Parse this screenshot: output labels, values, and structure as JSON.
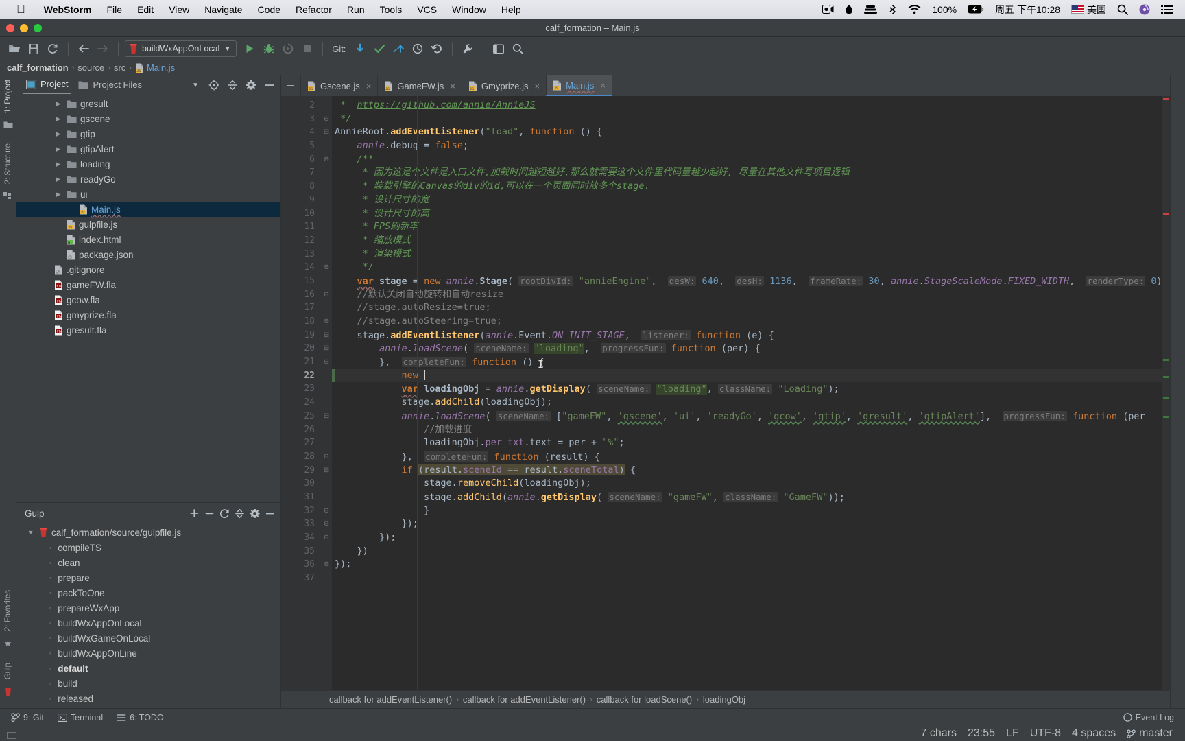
{
  "macmenu": {
    "apple_icon": "apple-icon",
    "app_name": "WebStorm",
    "items": [
      "File",
      "Edit",
      "View",
      "Navigate",
      "Code",
      "Refactor",
      "Run",
      "Tools",
      "VCS",
      "Window",
      "Help"
    ],
    "status": {
      "screen_record_icon": "screen-record-icon",
      "shield_icon": "shield-icon",
      "stack_icon": "stack-icon",
      "bluetooth_icon": "bluetooth-icon",
      "wifi_icon": "wifi-icon",
      "battery_percent": "100%",
      "battery_icon": "battery-charging-icon",
      "datetime": "周五 下午10:28",
      "input_source": "美国",
      "search_icon": "search-icon",
      "siri_icon": "siri-icon",
      "control_center_icon": "control-center-icon"
    }
  },
  "window": {
    "title": "calf_formation – Main.js"
  },
  "toolbar": {
    "open_icon": "open-folder-icon",
    "save_icon": "save-icon",
    "sync_icon": "sync-icon",
    "back_icon": "back-arrow-icon",
    "forward_icon": "forward-arrow-icon",
    "run_config": "buildWxAppOnLocal",
    "run_config_icon": "gulp-task-icon",
    "dropdown_icon": "chevron-down-icon",
    "run_icon": "run-icon",
    "debug_icon": "debug-icon",
    "coverage_icon": "run-coverage-icon",
    "stop_icon": "stop-icon",
    "git_label": "Git:",
    "git_update_icon": "update-project-icon",
    "git_commit_icon": "commit-checkmark-icon",
    "git_push_icon": "push-icon",
    "git_history_icon": "history-clock-icon",
    "git_revert_icon": "revert-icon",
    "settings_icon": "wrench-icon",
    "layout_icon": "layout-icon",
    "search_icon": "search-icon"
  },
  "breadcrumb": {
    "items": [
      {
        "label": "calf_formation",
        "icon": ""
      },
      {
        "label": "source",
        "icon": ""
      },
      {
        "label": "src",
        "icon": ""
      },
      {
        "label": "Main.js",
        "icon": "js-file-icon"
      }
    ],
    "separator": "›"
  },
  "left_rail": {
    "tabs": [
      {
        "label": "1: Project",
        "icon": "project-icon"
      },
      {
        "label": "2: Structure",
        "icon": "structure-icon"
      }
    ],
    "bottom_tabs": [
      {
        "label": "2: Favorites",
        "icon": "star-icon"
      },
      {
        "label": "Gulp",
        "icon": "gulp-icon"
      }
    ]
  },
  "project_panel": {
    "tabs": [
      {
        "label": "Project",
        "icon": "project-view-icon",
        "active": true
      },
      {
        "label": "Project Files",
        "icon": "folder-icon",
        "active": false
      }
    ],
    "header_icons": [
      "chevron-down-icon",
      "target-locate-icon",
      "collapse-all-icon",
      "gear-icon",
      "hide-icon"
    ],
    "tree": [
      {
        "label": "gresult",
        "icon": "folder-icon",
        "arrow": "▶",
        "indent": 3,
        "selected": false
      },
      {
        "label": "gscene",
        "icon": "folder-icon",
        "arrow": "▶",
        "indent": 3,
        "selected": false
      },
      {
        "label": "gtip",
        "icon": "folder-icon",
        "arrow": "▶",
        "indent": 3,
        "selected": false
      },
      {
        "label": "gtipAlert",
        "icon": "folder-icon",
        "arrow": "▶",
        "indent": 3,
        "selected": false
      },
      {
        "label": "loading",
        "icon": "folder-icon",
        "arrow": "▶",
        "indent": 3,
        "selected": false
      },
      {
        "label": "readyGo",
        "icon": "folder-icon",
        "arrow": "▶",
        "indent": 3,
        "selected": false
      },
      {
        "label": "ui",
        "icon": "folder-icon",
        "arrow": "▶",
        "indent": 3,
        "selected": false
      },
      {
        "label": "Main.js",
        "icon": "js-file-icon",
        "arrow": "",
        "indent": 4,
        "selected": true
      },
      {
        "label": "gulpfile.js",
        "icon": "js-file-icon",
        "arrow": "",
        "indent": 3,
        "selected": false
      },
      {
        "label": "index.html",
        "icon": "html-file-icon",
        "arrow": "",
        "indent": 3,
        "selected": false
      },
      {
        "label": "package.json",
        "icon": "json-file-icon",
        "arrow": "",
        "indent": 3,
        "selected": false
      },
      {
        "label": ".gitignore",
        "icon": "gitignore-file-icon",
        "arrow": "",
        "indent": 2,
        "selected": false
      },
      {
        "label": "gameFW.fla",
        "icon": "fla-file-icon",
        "arrow": "",
        "indent": 2,
        "selected": false
      },
      {
        "label": "gcow.fla",
        "icon": "fla-file-icon",
        "arrow": "",
        "indent": 2,
        "selected": false
      },
      {
        "label": "gmyprize.fla",
        "icon": "fla-file-icon",
        "arrow": "",
        "indent": 2,
        "selected": false
      },
      {
        "label": "gresult.fla",
        "icon": "fla-file-icon",
        "arrow": "",
        "indent": 2,
        "selected": false
      }
    ]
  },
  "gulp_panel": {
    "title": "Gulp",
    "header_icons": [
      "add-icon",
      "remove-icon",
      "refresh-icon",
      "collapse-all-icon",
      "gear-icon",
      "hide-icon"
    ],
    "root": {
      "label": "calf_formation/source/gulpfile.js",
      "arrow": "▼",
      "icon": "gulp-icon"
    },
    "tasks": [
      {
        "label": "compileTS",
        "bold": false
      },
      {
        "label": "clean",
        "bold": false
      },
      {
        "label": "prepare",
        "bold": false
      },
      {
        "label": "packToOne",
        "bold": false
      },
      {
        "label": "prepareWxApp",
        "bold": false
      },
      {
        "label": "buildWxAppOnLocal",
        "bold": false
      },
      {
        "label": "buildWxGameOnLocal",
        "bold": false
      },
      {
        "label": "buildWxAppOnLine",
        "bold": false
      },
      {
        "label": "default",
        "bold": true
      },
      {
        "label": "build",
        "bold": false
      },
      {
        "label": "released",
        "bold": false
      }
    ]
  },
  "editor": {
    "tabs": [
      {
        "label": "Gscene.js",
        "icon": "js-file-icon",
        "active": false,
        "close": "×"
      },
      {
        "label": "GameFW.js",
        "icon": "js-file-icon",
        "active": false,
        "close": "×"
      },
      {
        "label": "Gmyprize.js",
        "icon": "js-file-icon",
        "active": false,
        "close": "×"
      },
      {
        "label": "Main.js",
        "icon": "js-file-icon",
        "active": true,
        "close": "×"
      }
    ],
    "hide_icon": "hide-tabs-icon",
    "first_line_number": 2,
    "current_line": 22,
    "line_numbers": [
      2,
      3,
      4,
      5,
      6,
      7,
      8,
      9,
      10,
      11,
      12,
      13,
      14,
      15,
      16,
      17,
      18,
      19,
      20,
      21,
      22,
      23,
      24,
      25,
      26,
      27,
      28,
      29,
      30,
      31,
      32,
      33,
      34,
      35,
      36,
      37
    ],
    "folds": {
      "3": "⊖",
      "4": "⊟",
      "6": "⊖",
      "14": "⊖",
      "16": "⊖",
      "18": "⊖",
      "19": "⊟",
      "20": "⊟",
      "21": "⊖",
      "25": "⊟",
      "28": "⊖",
      "29": "⊟",
      "32": "⊖",
      "33": "⊖",
      "34": "⊖",
      "36": "⊖"
    },
    "breadcrumb": [
      "callback for addEventListener()",
      "callback for addEventListener()",
      "callback for loadScene()",
      "loadingObj"
    ],
    "breadcrumb_separator": "›",
    "code": [
      " *  https://github.com/annie/AnnieJS",
      " */",
      "AnnieRoot.addEventListener(\"load\", function () {",
      "    annie.debug = false;",
      "    /**",
      "     * 因为这是个文件是入口文件,加载时间越短越好,那么就需要这个文件里代码量越少越好, 尽量在其他文件写项目逻辑",
      "     * 装载引擎的Canvas的div的id,可以在一个页面同时放多个stage.",
      "     * 设计尺寸的宽",
      "     * 设计尺寸的高",
      "     * FPS刷新率",
      "     * 缩放模式",
      "     * 渲染模式",
      "     */",
      "    var stage = new annie.Stage( rootDivId: \"annieEngine\",  desW: 640,  desH: 1136,  frameRate: 30, annie.StageScaleMode.FIXED_WIDTH,  renderType: 0);",
      "    //默认关闭自动旋转和自动resize",
      "    //stage.autoResize=true;",
      "    //stage.autoSteering=true;",
      "    stage.addEventListener(annie.Event.ON_INIT_STAGE,  listener: function (e) {",
      "        annie.loadScene( sceneName: \"loading\",  progressFun: function (per) {",
      "        },  completeFun: function () {",
      "            new ",
      "            var loadingObj = annie.getDisplay( sceneName: \"loading\", className: \"Loading\");",
      "            stage.addChild(loadingObj);",
      "            annie.loadScene( sceneName: [\"gameFW\", 'gscene', 'ui', 'readyGo', 'gcow', 'gtip', 'gresult', 'gtipAlert'],  progressFun: function (per",
      "                //加载进度",
      "                loadingObj.per_txt.text = per + \"%\";",
      "            },  completeFun: function (result) {",
      "                if (result.sceneId == result.sceneTotal) {",
      "                    stage.removeChild(loadingObj);",
      "                    stage.addChild(annie.getDisplay( sceneName: \"gameFW\", className: \"GameFW\"));",
      "                }",
      "            });",
      "        });",
      "    })",
      "});",
      ""
    ]
  },
  "status_bar": {
    "left": [
      {
        "label": "9: Git",
        "icon": "git-branch-icon"
      },
      {
        "label": "Terminal",
        "icon": "terminal-icon"
      },
      {
        "label": "6: TODO",
        "icon": "todo-icon"
      }
    ],
    "event_log": {
      "label": "Event Log",
      "icon": "event-log-icon"
    },
    "right": [
      {
        "label": "7 chars",
        "name": "char-count"
      },
      {
        "label": "23:55",
        "name": "caret-position"
      },
      {
        "label": "LF",
        "name": "line-separator"
      },
      {
        "label": "UTF-8",
        "name": "file-encoding"
      },
      {
        "label": "4 spaces",
        "name": "indent-setting"
      },
      {
        "label": "master",
        "name": "git-branch",
        "icon": "git-branch-icon"
      }
    ]
  },
  "colors": {
    "accent_blue": "#4a88c7",
    "panel_bg": "#3c3f41",
    "editor_bg": "#2b2b2b",
    "selection_blue": "#0d293e",
    "string_green": "#6a8759",
    "keyword_orange": "#cc7832",
    "function_yellow": "#ffc66d"
  }
}
